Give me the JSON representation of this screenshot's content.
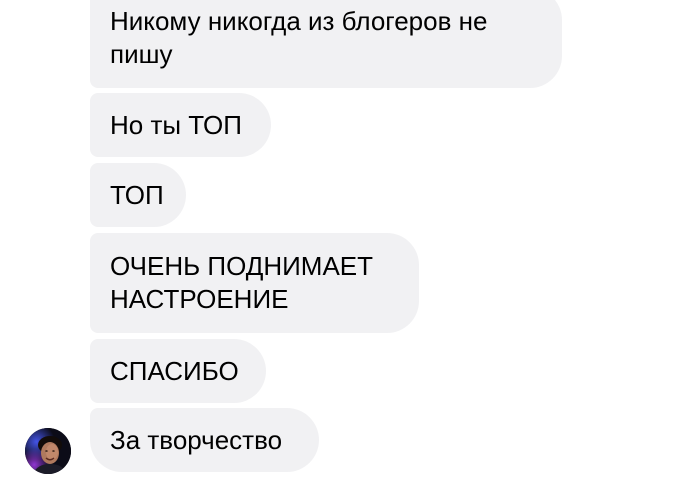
{
  "messages": [
    {
      "text": "Никому никогда из блогеров не пишу"
    },
    {
      "text": "Но ты ТОП"
    },
    {
      "text": "ТОП"
    },
    {
      "text": "ОЧЕНЬ ПОДНИМАЕТ НАСТРОЕНИЕ"
    },
    {
      "text": "СПАСИБО"
    },
    {
      "text": "За творчество"
    }
  ],
  "colors": {
    "bubble_bg": "#f1f1f3",
    "text": "#000000",
    "background": "#ffffff"
  },
  "sender": {
    "avatar_icon": "user-avatar-photo"
  }
}
